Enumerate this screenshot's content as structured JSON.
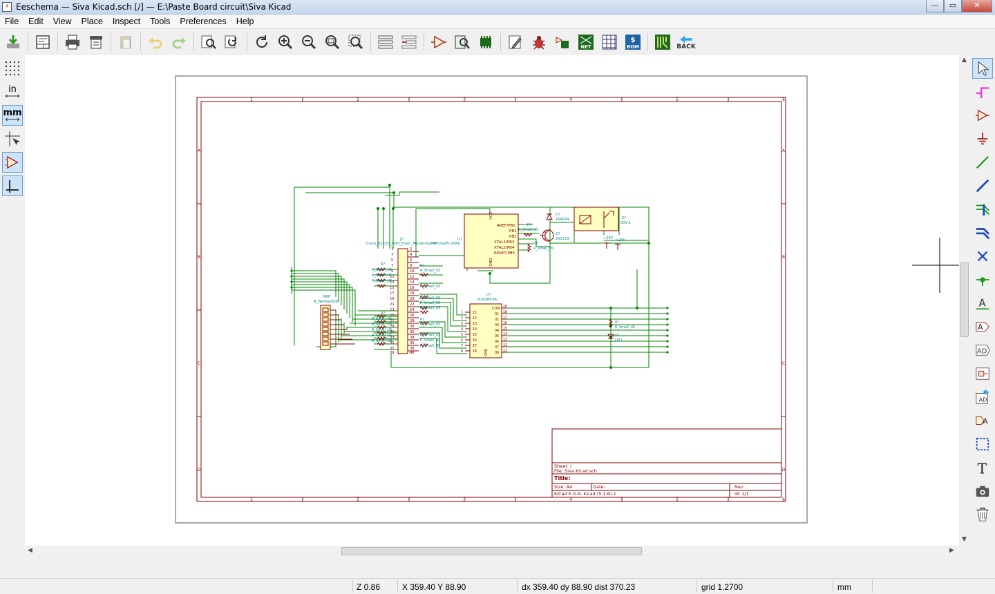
{
  "window": {
    "title": "Eeschema — Siva Kicad.sch [/] — E:\\Paste Board circuit\\Siva Kicad",
    "controls": {
      "minimize": "—",
      "maximize": "▭",
      "close": "✕"
    }
  },
  "menu": [
    "File",
    "Edit",
    "View",
    "Place",
    "Inspect",
    "Tools",
    "Preferences",
    "Help"
  ],
  "toolbar": {
    "back_label": "BACK",
    "net_label": "NET",
    "bom_label": "BOM"
  },
  "left_toolbar": {
    "units_in": "in",
    "units_mm": "mm"
  },
  "schematic": {
    "border_columns": [
      "1",
      "2",
      "3",
      "4",
      "5",
      "6"
    ],
    "border_rows": [
      "A",
      "B",
      "C",
      "D"
    ],
    "title_block": {
      "sheet": "Sheet: /",
      "file": "File: Siva Kicad.sch",
      "title": "Title:",
      "size": "Size: A4",
      "date": "Date:",
      "rev": "Rev:",
      "kicad": "KiCad E.D.A.  kicad (5.1.6)-1",
      "id": "Id: 1/1"
    },
    "components": {
      "j1_ref": "J?",
      "j1_value": "Conn_02x20_Odd_Even_MountingPin",
      "u1_ref": "U?",
      "u1_value": "ATtiny85-20PU",
      "u1_vcc": "VCC",
      "u1_gnd": "GND",
      "u1_pins": [
        "AREF/PB0",
        "PB1",
        "PB2",
        "XTAL1/PB3",
        "XTAL2/PB4",
        "RESET/PB5"
      ],
      "u2_ref": "U?",
      "u2_value": "ULN2803A",
      "u2_com": "COM",
      "u2_gnd": "GND",
      "q1_ref": "Q?",
      "q1_value": "2N2219",
      "d1_ref": "D?",
      "d1_value": "1N4004",
      "k1_ref": "K?",
      "k1_value": "G5V-1",
      "rn_ref": "RN?",
      "rn_value": "R_Network08",
      "r_ref": "R?",
      "r_value": "R_Small_US",
      "led_ref": "D?",
      "led_value": "LED",
      "pwr_24v": "+24V",
      "pwr_24v_b": "~24V"
    }
  },
  "status": {
    "zoom": "Z 0.86",
    "xy": "X 359.40  Y 88.90",
    "delta": "dx 359.40  dy 88.90  dist 370.23",
    "grid": "grid 1.2700",
    "units": "mm"
  },
  "colors": {
    "sheet_border": "#840000",
    "wire": "#008400",
    "component_fill": "#ffffc2",
    "component_outline": "#840000",
    "label_text": "#008484"
  }
}
